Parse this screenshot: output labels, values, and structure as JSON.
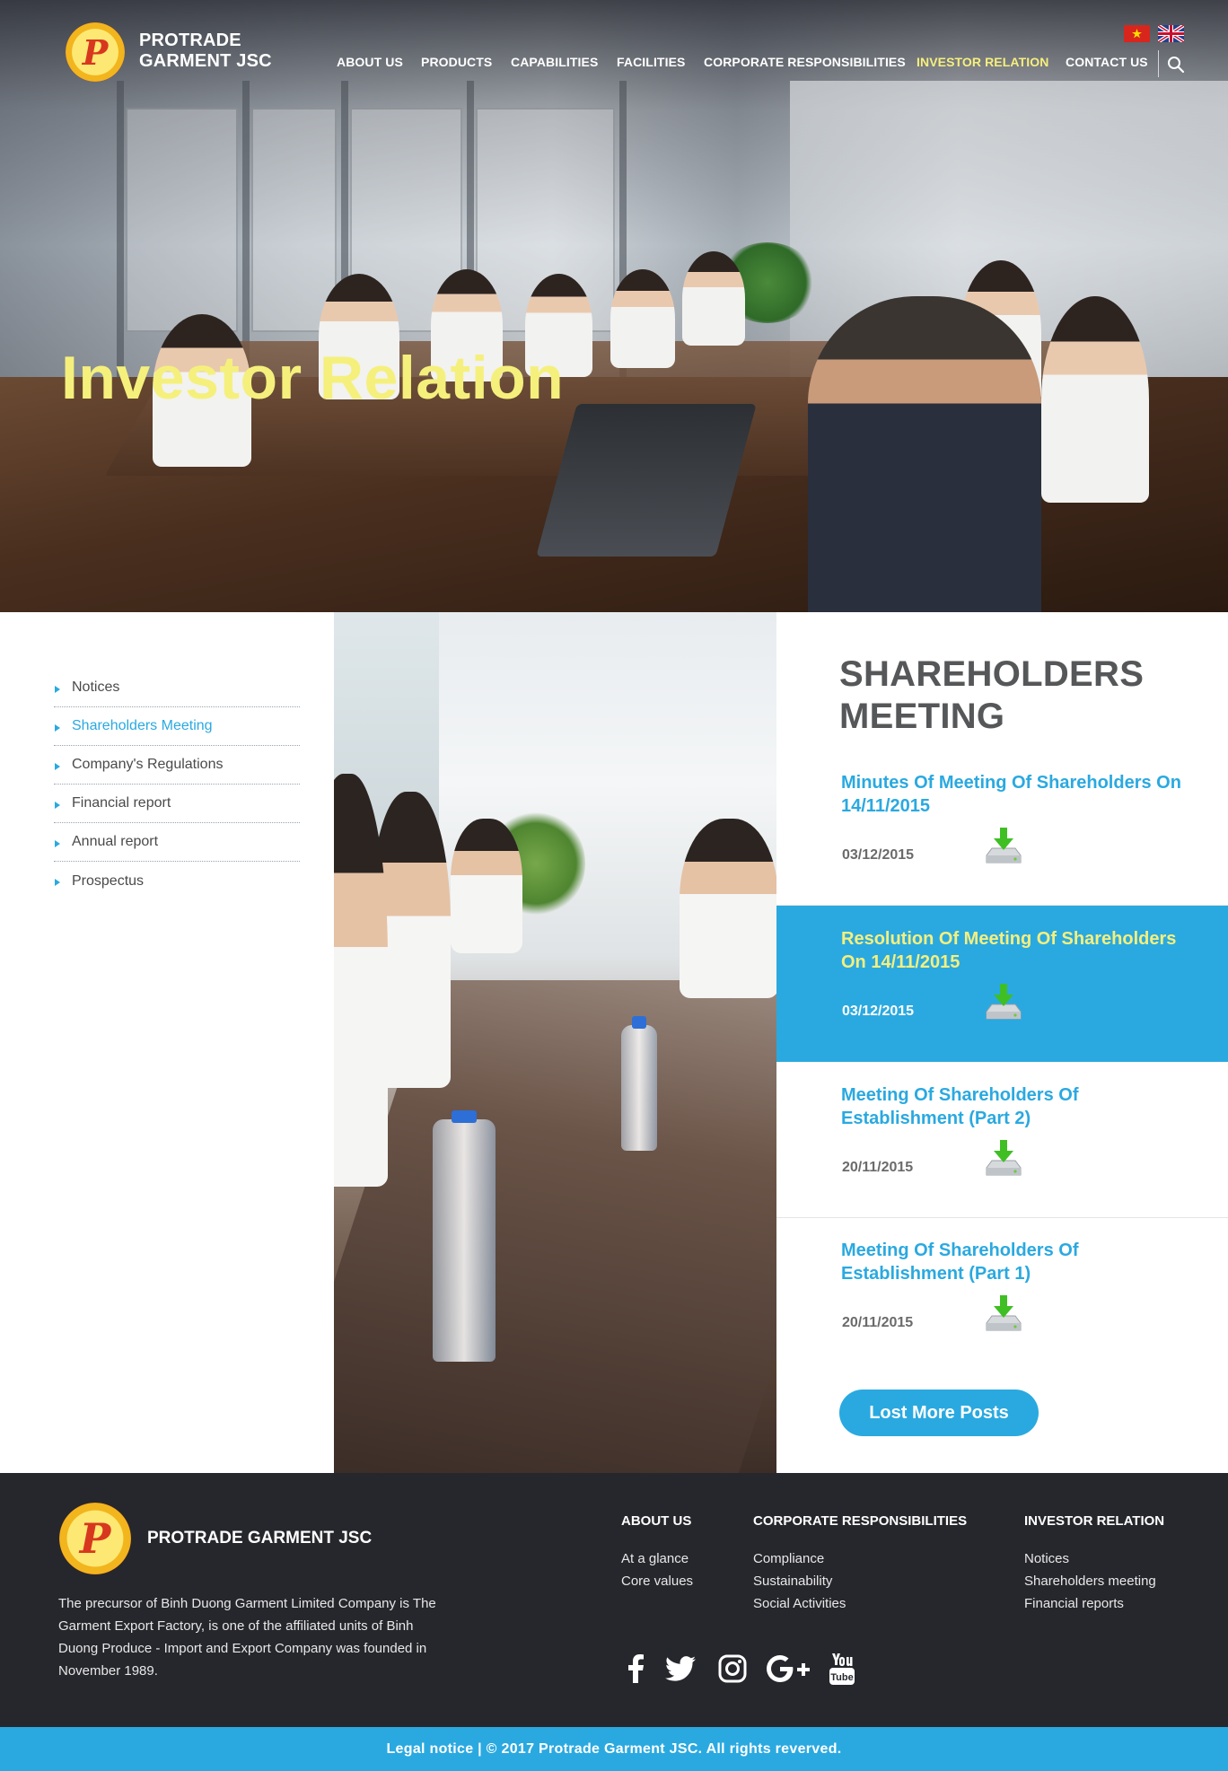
{
  "header": {
    "brand": "PROTRADE\nGARMENT JSC",
    "logo_letter": "P",
    "nav": [
      {
        "label": "ABOUT US"
      },
      {
        "label": "PRODUCTS"
      },
      {
        "label": "CAPABILITIES"
      },
      {
        "label": "FACILITIES"
      },
      {
        "label": "CORPORATE RESPONSIBILITIES"
      },
      {
        "label": "INVESTOR RELATION",
        "active": true
      },
      {
        "label": "CONTACT US"
      }
    ],
    "languages": [
      "vietnam-flag-icon",
      "uk-flag-icon"
    ],
    "search_icon": "search-icon"
  },
  "hero": {
    "title": "Investor Relation"
  },
  "sidebar": {
    "items": [
      {
        "label": "Notices"
      },
      {
        "label": "Shareholders Meeting",
        "active": true
      },
      {
        "label": "Company's Regulations"
      },
      {
        "label": "Financial report"
      },
      {
        "label": "Annual report"
      },
      {
        "label": "Prospectus"
      }
    ]
  },
  "main": {
    "title": "SHAREHOLDERS\nMEETING",
    "posts": [
      {
        "title": "Minutes Of Meeting Of Shareholders On 14/11/2015",
        "date": "03/12/2015",
        "icon": "download-icon"
      },
      {
        "title": "Resolution Of Meeting Of Shareholders On 14/11/2015",
        "date": "03/12/2015",
        "icon": "download-icon",
        "highlighted": true
      },
      {
        "title": "Meeting Of Shareholders Of Establishment (Part 2)",
        "date": "20/11/2015",
        "icon": "download-icon"
      },
      {
        "title": "Meeting Of Shareholders Of Establishment (Part 1)",
        "date": "20/11/2015",
        "icon": "download-icon"
      }
    ],
    "more_button": "Lost More Posts"
  },
  "footer": {
    "brand": "PROTRADE GARMENT JSC",
    "description": "The precursor of Binh Duong Garment Limited Company is The Garment Export Factory, is one of the affiliated units of Binh Duong Produce - Import and Export Company was founded in November 1989.",
    "columns": [
      {
        "heading": "ABOUT US",
        "links": [
          "At a glance",
          "Core values"
        ]
      },
      {
        "heading": "CORPORATE RESPONSIBILITIES",
        "links": [
          "Compliance",
          "Sustainability",
          "Social Activities"
        ]
      },
      {
        "heading": "INVESTOR RELATION",
        "links": [
          "Notices",
          "Shareholders meeting",
          "Financial reports"
        ]
      }
    ],
    "social": [
      "facebook-icon",
      "twitter-icon",
      "instagram-icon",
      "google-plus-icon",
      "youtube-icon"
    ],
    "legal": "Legal notice | © 2017 Protrade Garment JSC. All rights reverved."
  },
  "colors": {
    "accent": "#2aa9e0",
    "highlight_text": "#f6ef7d",
    "footer_bg": "#26272c"
  }
}
